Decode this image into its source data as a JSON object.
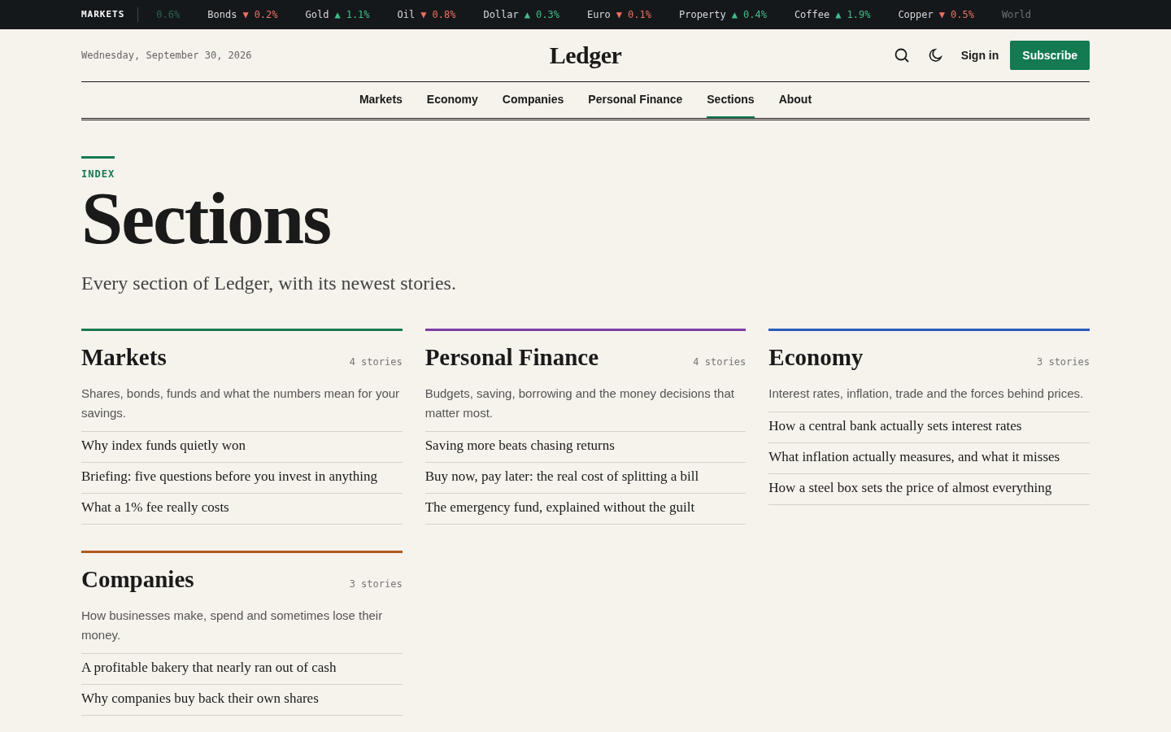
{
  "ticker": {
    "label": "MARKETS",
    "items": [
      {
        "change": "0.6%",
        "kind": "up",
        "faded": true
      },
      {
        "name": "Bonds",
        "arrow": "▼",
        "change": "0.2%",
        "kind": "down",
        "faded": false
      },
      {
        "name": "Gold",
        "arrow": "▲",
        "change": "1.1%",
        "kind": "up",
        "faded": false
      },
      {
        "name": "Oil",
        "arrow": "▼",
        "change": "0.8%",
        "kind": "down",
        "faded": false
      },
      {
        "name": "Dollar",
        "arrow": "▲",
        "change": "0.3%",
        "kind": "up",
        "faded": false
      },
      {
        "name": "Euro",
        "arrow": "▼",
        "change": "0.1%",
        "kind": "down",
        "faded": false
      },
      {
        "name": "Property",
        "arrow": "▲",
        "change": "0.4%",
        "kind": "up",
        "faded": false
      },
      {
        "name": "Coffee",
        "arrow": "▲",
        "change": "1.9%",
        "kind": "up",
        "faded": false
      },
      {
        "name": "Copper",
        "arrow": "▼",
        "change": "0.5%",
        "kind": "down",
        "faded": false
      },
      {
        "name": "World",
        "faded": true
      }
    ]
  },
  "masthead": {
    "date": "Wednesday, September 30, 2026",
    "logo": "Ledger",
    "sign_in": "Sign in",
    "subscribe": "Subscribe"
  },
  "nav": [
    {
      "label": "Markets",
      "selected": false
    },
    {
      "label": "Economy",
      "selected": false
    },
    {
      "label": "Companies",
      "selected": false
    },
    {
      "label": "Personal Finance",
      "selected": false
    },
    {
      "label": "Sections",
      "selected": true
    },
    {
      "label": "About",
      "selected": false
    }
  ],
  "page": {
    "eyebrow": "INDEX",
    "title": "Sections",
    "lede": "Every section of Ledger, with its newest stories."
  },
  "sections": [
    {
      "name": "Markets",
      "count": "4 stories",
      "color": "#1a7a52",
      "description": "Shares, bonds, funds and what the numbers mean for your savings.",
      "stories": [
        "Why index funds quietly won",
        "Briefing: five questions before you invest in anything",
        "What a 1% fee really costs"
      ]
    },
    {
      "name": "Personal Finance",
      "count": "4 stories",
      "color": "#7b3fa6",
      "description": "Budgets, saving, borrowing and the money decisions that matter most.",
      "stories": [
        "Saving more beats chasing returns",
        "Buy now, pay later: the real cost of splitting a bill",
        "The emergency fund, explained without the guilt"
      ]
    },
    {
      "name": "Economy",
      "count": "3 stories",
      "color": "#2a5cb8",
      "description": "Interest rates, inflation, trade and the forces behind prices.",
      "stories": [
        "How a central bank actually sets interest rates",
        "What inflation actually measures, and what it misses",
        "How a steel box sets the price of almost everything"
      ]
    },
    {
      "name": "Companies",
      "count": "3 stories",
      "color": "#b05a1e",
      "description": "How businesses make, spend and sometimes lose their money.",
      "stories": [
        "A profitable bakery that nearly ran out of cash",
        "Why companies buy back their own shares"
      ]
    }
  ]
}
